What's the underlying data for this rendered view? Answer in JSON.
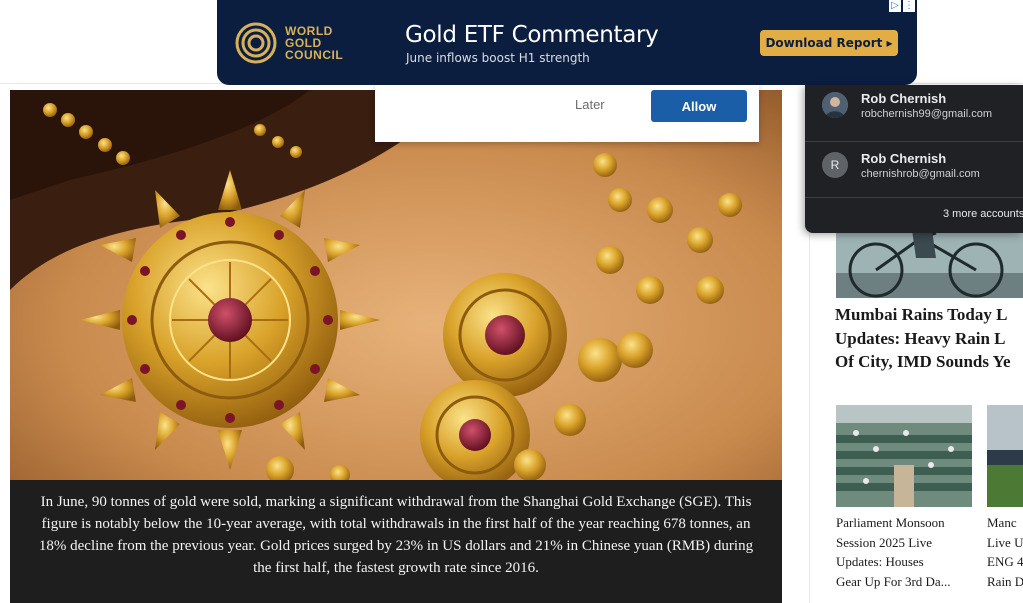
{
  "ad": {
    "logo_lines": [
      "WORLD",
      "GOLD",
      "COUNCIL"
    ],
    "title": "Gold ETF Commentary",
    "subtitle": "June inflows boost H1 strength",
    "cta": "Download Report ▸",
    "choices": [
      "▷",
      "⋮"
    ],
    "colors": {
      "background": "#0c1e3f",
      "accent": "#e3ad45"
    }
  },
  "notification": {
    "later": "Later",
    "allow": "Allow"
  },
  "hero": {
    "caption": "In June, 90 tonnes of gold were sold, marking a significant withdrawal from the Shanghai Gold Exchange (SGE). This figure is notably below the 10-year average, with total withdrawals in the first half of the year reaching 678 tonnes, an 18% decline from the previous year. Gold prices surged by 23% in US dollars and 21% in Chinese yuan (RMB) during the first half, the fastest growth rate since 2016."
  },
  "account_chooser": {
    "accounts": [
      {
        "name": "Rob Chernish",
        "email": "robchernish99@gmail.com",
        "avatar": "photo"
      },
      {
        "name": "Rob Chernish",
        "email": "chernishrob@gmail.com",
        "avatar": "R"
      }
    ],
    "more": "3 more accounts"
  },
  "sidebar": {
    "headline": {
      "lines": [
        "Mumbai Rains Today L",
        "Updates: Heavy Rain L",
        "Of City, IMD Sounds Ye"
      ]
    },
    "cards": [
      {
        "lines": [
          "Parliament Monsoon",
          "Session 2025 Live",
          "Updates: Houses",
          "Gear Up For 3rd Da..."
        ]
      },
      {
        "lines": [
          "Manc",
          "Live U",
          "ENG 4",
          "Rain D"
        ]
      }
    ]
  }
}
